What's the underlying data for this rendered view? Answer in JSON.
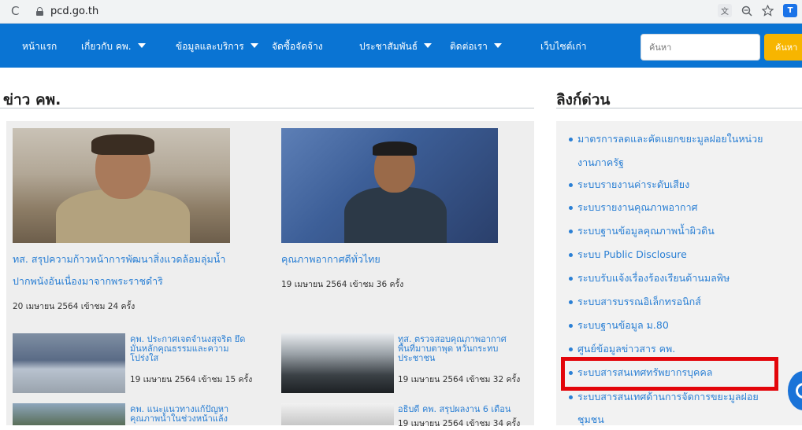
{
  "browser": {
    "url": "pcd.go.th",
    "reload_glyph": "C",
    "extension_label": "T"
  },
  "nav": {
    "items": [
      {
        "label": "หน้าแรก",
        "dropdown": false
      },
      {
        "label": "เกี่ยวกับ คพ.",
        "dropdown": true
      },
      {
        "label": "ข้อมูลและบริการ",
        "dropdown": true
      },
      {
        "label": "จัดซื้อจัดจ้าง",
        "dropdown": false
      },
      {
        "label": "ประชาสัมพันธ์",
        "dropdown": true
      },
      {
        "label": "ติดต่อเรา",
        "dropdown": true
      },
      {
        "label": "เว็บไซต์เก่า",
        "dropdown": false
      }
    ],
    "search_placeholder": "ค้นหา",
    "search_button": "ค้นหา"
  },
  "news": {
    "title": "ข่าว คพ.",
    "featured": [
      {
        "title_line1": "ทส. สรุปความก้าวหน้าการพัฒนาสิ่งแวดล้อมลุ่มน้ำ",
        "title_line2": "ปากพนังอันเนื่องมาจากพระราชดำริ",
        "meta": "20 เมษายน 2564  เข้าชม 24 ครั้ง"
      },
      {
        "title_line1": "คุณภาพอากาศดีทั่วไทย",
        "meta": "19 เมษายน 2564  เข้าชม 36 ครั้ง"
      }
    ],
    "small": [
      {
        "title_lines": [
          "คพ. ประกาศเจตจำนงสุจริต ยึด",
          "มั่นหลักคุณธรรมและความ",
          "โปร่งใส"
        ],
        "meta": "19 เมษายน 2564 เข้าชม 15 ครั้ง"
      },
      {
        "title_lines": [
          "ทส. ตรวจสอบคุณภาพอากาศ",
          "พื้นที่มาบตาพุด หวั่นกระทบ",
          "ประชาชน"
        ],
        "meta": "19 เมษายน 2564 เข้าชม 32 ครั้ง"
      },
      {
        "title_lines": [
          "คพ. แนะแนวทางแก้ปัญหา",
          "คุณภาพน้ำในช่วงหน้าแล้ง"
        ],
        "meta": ""
      },
      {
        "title_lines": [
          "อธิบดี คพ. สรุปผลงาน 6 เดือน"
        ],
        "meta": "19 เมษายน 2564 เข้าชม 34 ครั้ง"
      }
    ]
  },
  "quick_links": {
    "title": "ลิงก์ด่วน",
    "items": [
      "มาตรการลดและคัดแยกขยะมูลฝอยในหน่วย",
      "งานภาครัฐ",
      "ระบบรายงานค่าระดับเสียง",
      "ระบบรายงานคุณภาพอากาศ",
      "ระบบฐานข้อมูลคุณภาพน้ำผิวดิน",
      "ระบบ Public Disclosure",
      "ระบบรับแจ้งเรื่องร้องเรียนด้านมลพิษ",
      "ระบบสารบรรณอิเล็กทรอนิกส์",
      "ระบบฐานข้อมูล ม.80",
      "ศูนย์ข้อมูลข่าวสาร คพ.",
      "ระบบสารสนเทศทรัพยากรบุคคล",
      "ระบบสารสนเทศด้านการจัดการขยะมูลฝอย",
      "ชุมชน"
    ],
    "highlighted_index": 10
  },
  "colors": {
    "nav_bg": "#0a74d3",
    "link": "#2a7fd4",
    "search_button": "#f7b500",
    "highlight": "#e3050a"
  }
}
